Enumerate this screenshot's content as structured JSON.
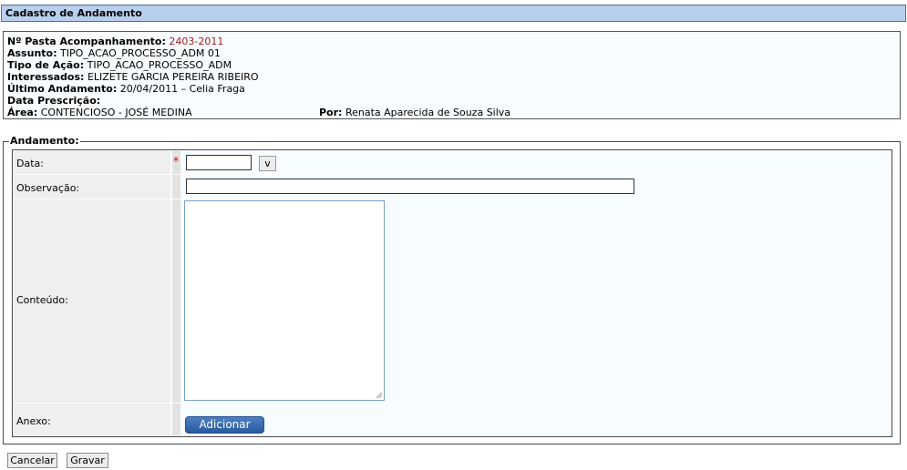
{
  "header": {
    "title": "Cadastro de Andamento"
  },
  "info": {
    "pasta_label": "Nº Pasta Acompanhamento:",
    "pasta_value": "2403-2011",
    "assunto_label": "Assunto:",
    "assunto_value": "TIPO_ACAO_PROCESSO_ADM 01",
    "tipo_label": "Tipo de Ação:",
    "tipo_value": "TIPO_ACAO_PROCESSO_ADM",
    "interessados_label": "Interessados:",
    "interessados_value": "ELIZETE GARCIA PEREIRA RIBEIRO",
    "ultimo_label": "Último Andamento:",
    "ultimo_value": "20/04/2011 – Celia Fraga",
    "prescricao_label": "Data Prescrição:",
    "area_label": "Área:",
    "area_value": "CONTENCIOSO - JOSÉ MEDINA",
    "por_label": "Por:",
    "por_value": "Renata Aparecida de Souza Silva"
  },
  "form": {
    "legend": "Andamento:",
    "data_label": "Data:",
    "required_mark": "*",
    "data_value": "",
    "date_button": "v",
    "observacao_label": "Observação:",
    "observacao_value": "",
    "conteudo_label": "Conteúdo:",
    "conteudo_value": "",
    "anexo_label": "Anexo:",
    "adicionar_button": "Adicionar"
  },
  "actions": {
    "cancelar": "Cancelar",
    "gravar": "Gravar"
  },
  "colors": {
    "title_bg": "#b8cfee",
    "required": "#cc0000",
    "pasta_number": "#9e1b1b",
    "primary_button": "#3a6bb0"
  }
}
